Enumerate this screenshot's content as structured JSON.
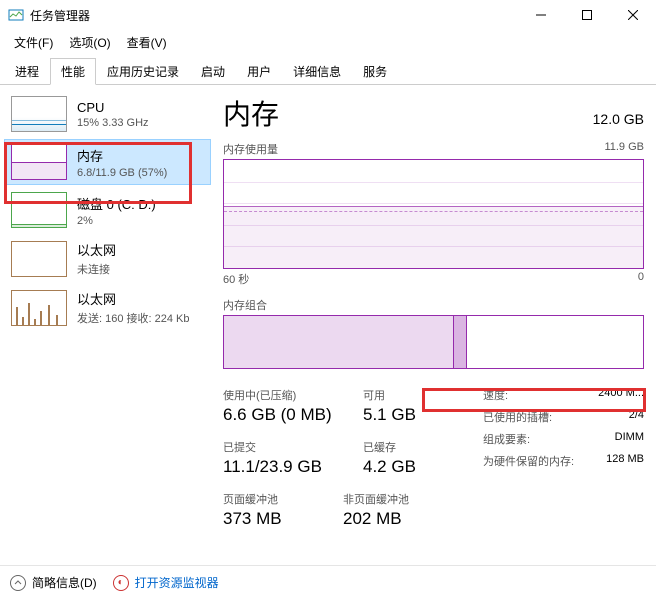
{
  "window": {
    "title": "任务管理器"
  },
  "menu": {
    "file": "文件(F)",
    "options": "选项(O)",
    "view": "查看(V)"
  },
  "tabs": [
    "进程",
    "性能",
    "应用历史记录",
    "启动",
    "用户",
    "详细信息",
    "服务"
  ],
  "active_tab": "性能",
  "sidebar": [
    {
      "title": "CPU",
      "sub": "15% 3.33 GHz"
    },
    {
      "title": "内存",
      "sub": "6.8/11.9 GB (57%)"
    },
    {
      "title": "磁盘 0 (C: D:)",
      "sub": "2%"
    },
    {
      "title": "以太网",
      "sub": "未连接"
    },
    {
      "title": "以太网",
      "sub": "发送: 160 接收: 224 Kb"
    }
  ],
  "main": {
    "title": "内存",
    "total": "12.0 GB",
    "usage_label": "内存使用量",
    "usage_max": "11.9 GB",
    "x_left": "60 秒",
    "x_right": "0",
    "comp_label": "内存组合"
  },
  "stats": {
    "in_use_label": "使用中(已压缩)",
    "in_use_value": "6.6 GB (0 MB)",
    "avail_label": "可用",
    "avail_value": "5.1 GB",
    "committed_label": "已提交",
    "committed_value": "11.1/23.9 GB",
    "cached_label": "已缓存",
    "cached_value": "4.2 GB",
    "paged_label": "页面缓冲池",
    "paged_value": "373 MB",
    "nonpaged_label": "非页面缓冲池",
    "nonpaged_value": "202 MB"
  },
  "details": {
    "speed_k": "速度:",
    "speed_v": "2400 M...",
    "slots_k": "已使用的插槽:",
    "slots_v": "2/4",
    "form_k": "组成要素:",
    "form_v": "DIMM",
    "reserved_k": "为硬件保留的内存:",
    "reserved_v": "128 MB"
  },
  "footer": {
    "fewer": "简略信息(D)",
    "resmon": "打开资源监视器"
  },
  "chart_data": {
    "type": "area",
    "title": "内存使用量",
    "ylabel": "GB",
    "ylim": [
      0,
      11.9
    ],
    "xlabel": "秒",
    "xlim": [
      60,
      0
    ],
    "series": [
      {
        "name": "使用中",
        "approx_constant_value": 6.8
      }
    ],
    "note": "Approx flat line at ~57% (6.8/11.9 GB)"
  }
}
